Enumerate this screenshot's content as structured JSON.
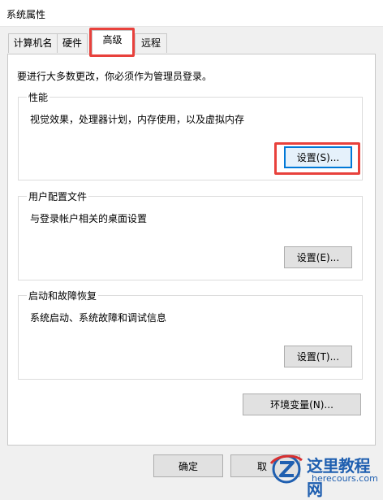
{
  "window": {
    "title": "系统属性"
  },
  "tabs": [
    {
      "label": "计算机名"
    },
    {
      "label": "硬件"
    },
    {
      "label": "高级"
    },
    {
      "label": "远程"
    }
  ],
  "active_tab": "高级",
  "intro_text": "要进行大多数更改，你必须作为管理员登录。",
  "groups": {
    "performance": {
      "title": "性能",
      "description": "视觉效果，处理器计划，内存使用，以及虚拟内存",
      "button": "设置(S)..."
    },
    "user_profile": {
      "title": "用户配置文件",
      "description": "与登录帐户相关的桌面设置",
      "button": "设置(E)..."
    },
    "startup_recovery": {
      "title": "启动和故障恢复",
      "description": "系统启动、系统故障和调试信息",
      "button": "设置(T)..."
    }
  },
  "env_button": "环境变量(N)...",
  "footer": {
    "ok": "确定",
    "cancel": "取"
  },
  "watermark": {
    "name": "这里教程网",
    "url": "herecours.com"
  },
  "colors": {
    "highlight": "#e8413c",
    "focus": "#0078d7",
    "watermark": "#1f5fb0"
  }
}
